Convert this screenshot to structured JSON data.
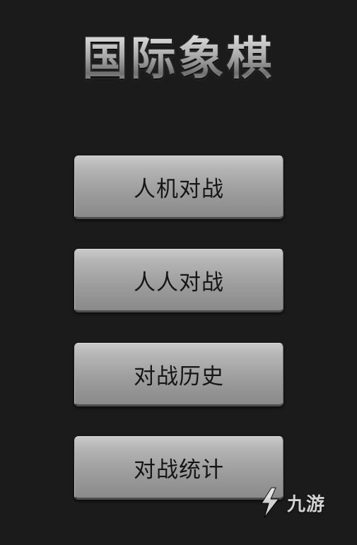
{
  "app": {
    "title": "国际象棋"
  },
  "menu": {
    "items": [
      {
        "label": "人机对战"
      },
      {
        "label": "人人对战"
      },
      {
        "label": "对战历史"
      },
      {
        "label": "对战统计"
      }
    ]
  },
  "watermark": {
    "text": "九游",
    "icon": "jiuyou-logo-icon"
  },
  "colors": {
    "background": "#1b1b1b",
    "button": "#a8a8a8",
    "button_text": "#161616"
  }
}
